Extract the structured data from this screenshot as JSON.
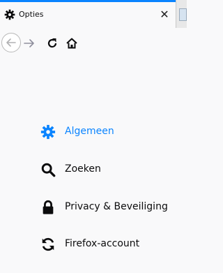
{
  "tab": {
    "title": "Opties",
    "close_symbol": "✕"
  },
  "menu": [
    {
      "label": "Algemeen",
      "icon": "gear-icon",
      "active": true
    },
    {
      "label": "Zoeken",
      "icon": "search-icon",
      "active": false
    },
    {
      "label": "Privacy & Beveiliging",
      "icon": "lock-icon",
      "active": false
    },
    {
      "label": "Firefox-account",
      "icon": "sync-icon",
      "active": false
    }
  ],
  "colors": {
    "accent": "#0a84ff",
    "text": "#0c0c0d",
    "background": "#f9f9fa"
  }
}
